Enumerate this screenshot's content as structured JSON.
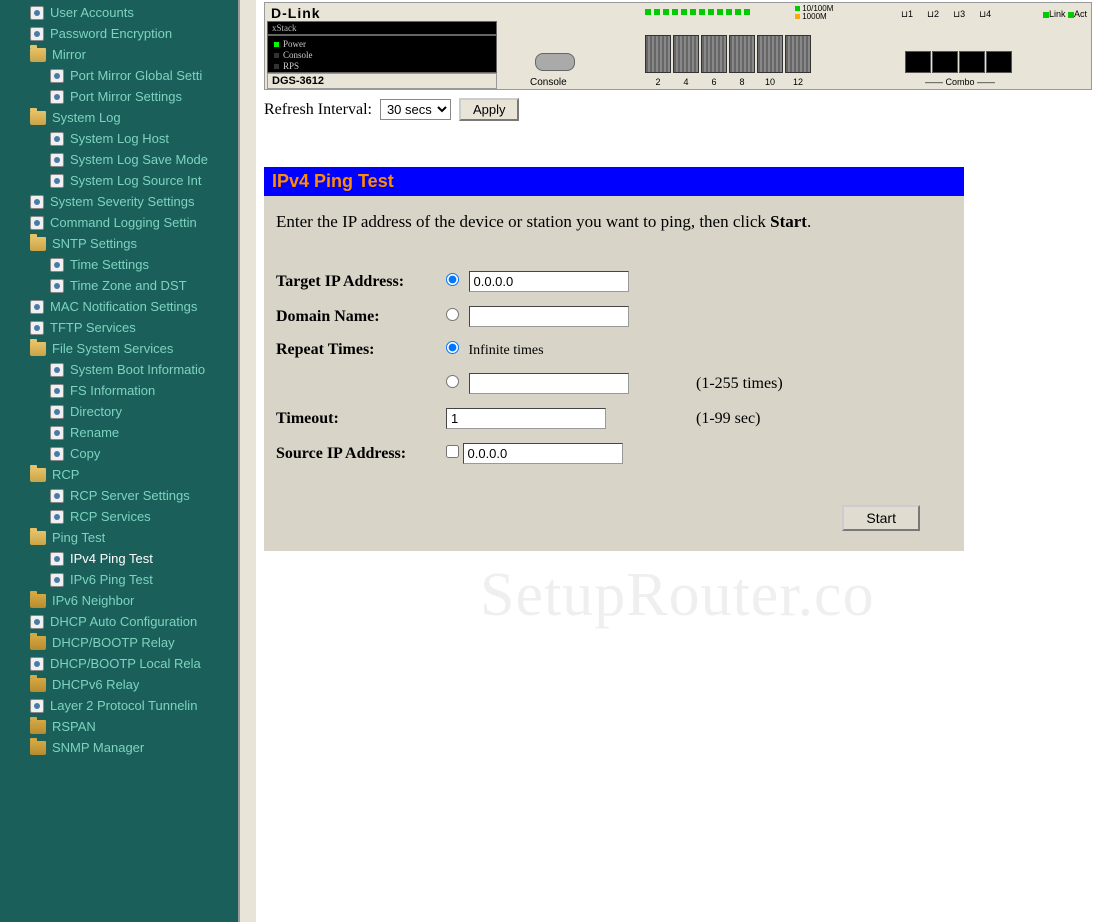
{
  "device": {
    "brand": "D-Link",
    "stack_label": "xStack",
    "model": "DGS-3612",
    "status": {
      "power": "Power",
      "console": "Console",
      "rps": "RPS"
    },
    "console_label": "Console",
    "port_numbers": [
      "2",
      "4",
      "6",
      "8",
      "10",
      "12"
    ],
    "speed_top": "10/100M",
    "speed_bottom": "1000M",
    "combo_label": "Combo",
    "combo_nums": [
      "1",
      "2",
      "3",
      "4"
    ],
    "linkact": {
      "link": "Link",
      "act": "Act"
    }
  },
  "refresh": {
    "label": "Refresh Interval:",
    "value": "30 secs",
    "apply": "Apply"
  },
  "panel": {
    "title": "IPv4 Ping Test",
    "hint_pre": "Enter the IP address of the device or station you want to ping, then click ",
    "hint_bold": "Start",
    "hint_post": ".",
    "fields": {
      "target_ip": {
        "label": "Target IP Address:",
        "value": "0.0.0.0"
      },
      "domain_name": {
        "label": "Domain Name:",
        "value": ""
      },
      "repeat": {
        "label": "Repeat Times:",
        "infinite": "Infinite times",
        "count_value": "",
        "count_help": "(1-255 times)"
      },
      "timeout": {
        "label": "Timeout:",
        "value": "1",
        "help": "(1-99 sec)"
      },
      "source_ip": {
        "label": "Source IP Address:",
        "value": "0.0.0.0"
      }
    },
    "start": "Start"
  },
  "tree": [
    {
      "depth": 1,
      "icon": "doc",
      "label": "User Accounts"
    },
    {
      "depth": 1,
      "icon": "doc",
      "label": "Password Encryption"
    },
    {
      "depth": 1,
      "icon": "folder-open",
      "label": "Mirror"
    },
    {
      "depth": 2,
      "icon": "doc",
      "label": "Port Mirror Global Setti"
    },
    {
      "depth": 2,
      "icon": "doc",
      "label": "Port Mirror Settings"
    },
    {
      "depth": 1,
      "icon": "folder-open",
      "label": "System Log"
    },
    {
      "depth": 2,
      "icon": "doc",
      "label": "System Log Host"
    },
    {
      "depth": 2,
      "icon": "doc",
      "label": "System Log Save Mode"
    },
    {
      "depth": 2,
      "icon": "doc",
      "label": "System Log Source Int"
    },
    {
      "depth": 1,
      "icon": "doc",
      "label": "System Severity Settings"
    },
    {
      "depth": 1,
      "icon": "doc",
      "label": "Command Logging Settin"
    },
    {
      "depth": 1,
      "icon": "folder-open",
      "label": "SNTP Settings"
    },
    {
      "depth": 2,
      "icon": "doc",
      "label": "Time Settings"
    },
    {
      "depth": 2,
      "icon": "doc",
      "label": "Time Zone and DST"
    },
    {
      "depth": 1,
      "icon": "doc",
      "label": "MAC Notification Settings"
    },
    {
      "depth": 1,
      "icon": "doc",
      "label": "TFTP Services"
    },
    {
      "depth": 1,
      "icon": "folder-open",
      "label": "File System Services"
    },
    {
      "depth": 2,
      "icon": "doc",
      "label": "System Boot Informatio"
    },
    {
      "depth": 2,
      "icon": "doc",
      "label": "FS Information"
    },
    {
      "depth": 2,
      "icon": "doc",
      "label": "Directory"
    },
    {
      "depth": 2,
      "icon": "doc",
      "label": "Rename"
    },
    {
      "depth": 2,
      "icon": "doc",
      "label": "Copy"
    },
    {
      "depth": 1,
      "icon": "folder-open",
      "label": "RCP"
    },
    {
      "depth": 2,
      "icon": "doc",
      "label": "RCP Server Settings"
    },
    {
      "depth": 2,
      "icon": "doc",
      "label": "RCP Services"
    },
    {
      "depth": 1,
      "icon": "folder-open",
      "label": "Ping Test"
    },
    {
      "depth": 2,
      "icon": "doc",
      "label": "IPv4 Ping Test",
      "selected": true
    },
    {
      "depth": 2,
      "icon": "doc",
      "label": "IPv6 Ping Test"
    },
    {
      "depth": 1,
      "icon": "folder-closed",
      "label": "IPv6 Neighbor"
    },
    {
      "depth": 1,
      "icon": "doc",
      "label": "DHCP Auto Configuration"
    },
    {
      "depth": 1,
      "icon": "folder-closed",
      "label": "DHCP/BOOTP Relay"
    },
    {
      "depth": 1,
      "icon": "doc",
      "label": "DHCP/BOOTP Local Rela"
    },
    {
      "depth": 1,
      "icon": "folder-closed",
      "label": "DHCPv6 Relay"
    },
    {
      "depth": 1,
      "icon": "doc",
      "label": "Layer 2 Protocol Tunnelin"
    },
    {
      "depth": 1,
      "icon": "folder-closed",
      "label": "RSPAN"
    },
    {
      "depth": 1,
      "icon": "folder-closed",
      "label": "SNMP Manager"
    }
  ],
  "watermark": "SetupRouter.co"
}
